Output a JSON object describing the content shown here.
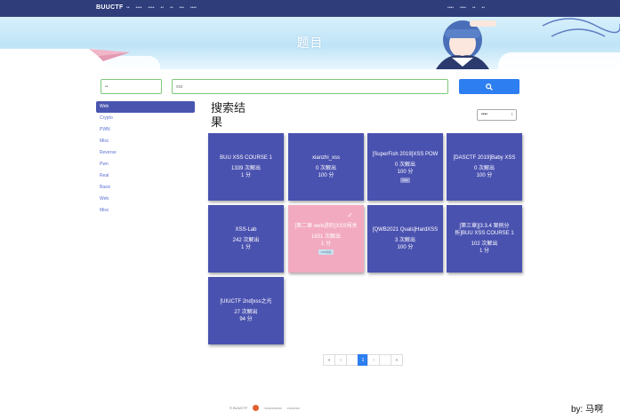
{
  "nav": {
    "brand": "BUUCTF",
    "left_links": [
      "••",
      "••••",
      "••••",
      "••",
      "••",
      "•••",
      "••••"
    ],
    "right_links": [
      "••••",
      "••••",
      "••",
      "••"
    ]
  },
  "banner": {
    "title": "题目"
  },
  "search": {
    "category_placeholder": "••",
    "keyword_placeholder": "xss"
  },
  "sidebar": {
    "items": [
      "Web",
      "Crypto",
      "PWN",
      "Misc",
      "Reverse",
      "Pwn",
      "Real",
      "Basic",
      "Web",
      "Misc"
    ]
  },
  "results": {
    "title": "搜索结果",
    "sort_label": "••••"
  },
  "challenges": [
    {
      "name": "BUU XSS COURSE 1",
      "solves": "1339 次解出",
      "points": "1 分",
      "tag": "",
      "solved": false
    },
    {
      "name": "xianzhi_xss",
      "solves": "0 次解出",
      "points": "100 分",
      "tag": "",
      "solved": false
    },
    {
      "name": "[SuperFish 2019]XSS POW",
      "solves": "0 次解出",
      "points": "100 分",
      "tag": "XSS",
      "solved": false
    },
    {
      "name": "[DASCTF 2019]Baby XSS",
      "solves": "0 次解出",
      "points": "100 分",
      "tag": "",
      "solved": false
    },
    {
      "name": "XSS-Lab",
      "solves": "242 次解出",
      "points": "1 分",
      "tag": "",
      "solved": false
    },
    {
      "name": "[第二章 web进阶]XSS闯关",
      "solves": "1831 次解出",
      "points": "1 分",
      "tag": "XSS闯关",
      "solved": true
    },
    {
      "name": "[QWB2021 Quals]HardXSS",
      "solves": "3 次解出",
      "points": "100 分",
      "tag": "",
      "solved": false
    },
    {
      "name": "[第三章][3.3.4 案例分析]BUU XSS COURSE 1",
      "solves": "102 次解出",
      "points": "1 分",
      "tag": "",
      "solved": false
    },
    {
      "name": "[UIUCTF 2nd]xss之光",
      "solves": "27 次解出",
      "points": "94 分",
      "tag": "",
      "solved": false
    }
  ],
  "pagination": {
    "first": "«",
    "prev": "‹",
    "current": "1",
    "next": "›",
    "last": "»"
  },
  "footer": {
    "left": "© BUUCTF",
    "middle": "••••••••••••••",
    "right": "••••••••••"
  },
  "signature": "by: 马啊",
  "colors": {
    "nav": "#2f3d7a",
    "card": "#4a52b0",
    "card_solved": "#f2aac0",
    "accent": "#2d7ef0",
    "input_border": "#7cc979"
  }
}
